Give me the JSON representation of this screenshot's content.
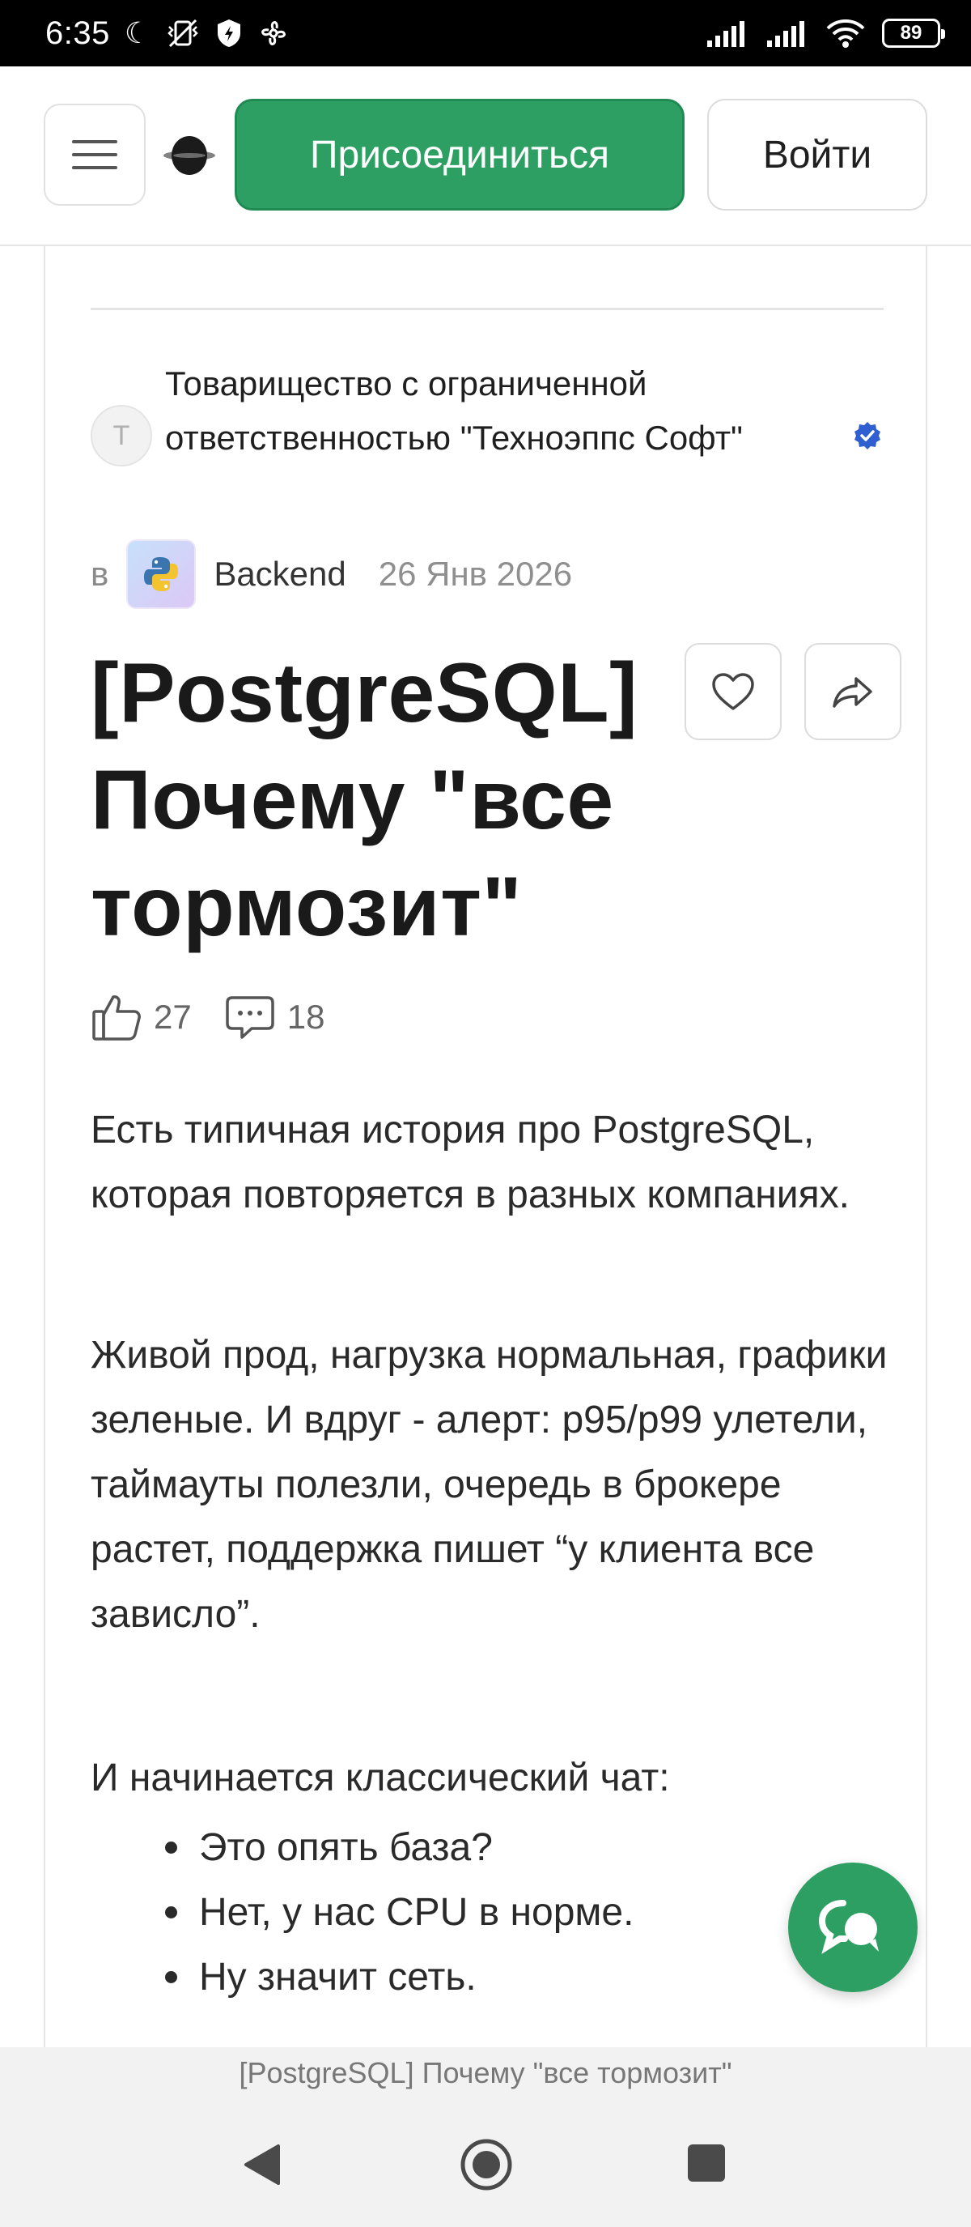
{
  "status_bar": {
    "time": "6:35",
    "battery": "89"
  },
  "header": {
    "join_label": "Присоединиться",
    "login_label": "Войти"
  },
  "article": {
    "author": "Товарищество с ограниченной ответственностью \"Техноэппс Софт\"",
    "author_initial": "Т",
    "in_label": "в",
    "hub": "Backend",
    "date": "26 Янв 2026",
    "title": "[PostgreSQL] Почему \"все тормозит\"",
    "likes": "27",
    "comments": "18",
    "paragraphs": [
      "Есть типичная история про PostgreSQL, которая повторяется в разных компаниях.",
      "Живой прод, нагрузка нормальная, графики зеленые. И вдруг - алерт: p95/p99 улетели, таймауты полезли, очередь в брокере растет, поддержка пишет “у клиента все зависло”.",
      "И начинается классический чат:"
    ],
    "bullets": [
      "Это опять база?",
      "Нет, у нас CPU в норме.",
      "Ну значит сеть."
    ]
  },
  "browser": {
    "tab_title": "[PostgreSQL] Почему \"все тормозит\""
  },
  "colors": {
    "brand_green": "#2e9f63",
    "verified_blue": "#2f5fd0"
  },
  "icons": {
    "menu": "hamburger-menu-icon",
    "logo": "habr-logo-icon",
    "verified": "verified-badge-icon",
    "hub": "python-icon",
    "favorite": "heart-icon",
    "share": "share-arrow-icon",
    "likes": "thumbs-up-icon",
    "comments": "comment-bubble-icon",
    "chat": "chat-icon"
  }
}
